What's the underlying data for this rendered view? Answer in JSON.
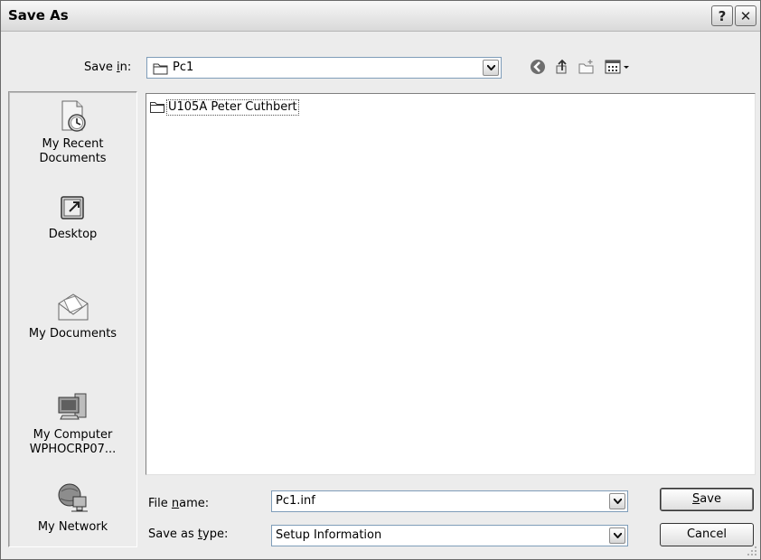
{
  "dialog": {
    "title": "Save As",
    "help_glyph": "?",
    "close_glyph": "✕"
  },
  "toolbar": {
    "save_in_label_pre": "Save ",
    "save_in_label_key": "i",
    "save_in_label_post": "n:",
    "save_in_value": "Pc1",
    "icons": [
      "back-icon",
      "up-folder-icon",
      "new-folder-icon",
      "views-icon"
    ]
  },
  "places": [
    {
      "label": "My Recent Documents",
      "icon": "recent-documents-icon"
    },
    {
      "label": "Desktop",
      "icon": "desktop-icon"
    },
    {
      "label": "My Documents",
      "icon": "my-documents-icon"
    },
    {
      "label": "My Computer WPHOCRP07...",
      "icon": "my-computer-icon"
    },
    {
      "label": "My Network",
      "icon": "my-network-icon"
    }
  ],
  "files": [
    {
      "name": "U105A Peter Cuthbert",
      "icon": "folder-icon"
    }
  ],
  "form": {
    "file_name_label_pre": "File ",
    "file_name_label_key": "n",
    "file_name_label_post": "ame:",
    "file_name_value": "Pc1.inf",
    "save_type_label_pre": "Save as ",
    "save_type_label_key": "t",
    "save_type_label_post": "ype:",
    "save_type_value": "Setup Information"
  },
  "buttons": {
    "save_key": "S",
    "save_rest": "ave",
    "cancel": "Cancel"
  }
}
